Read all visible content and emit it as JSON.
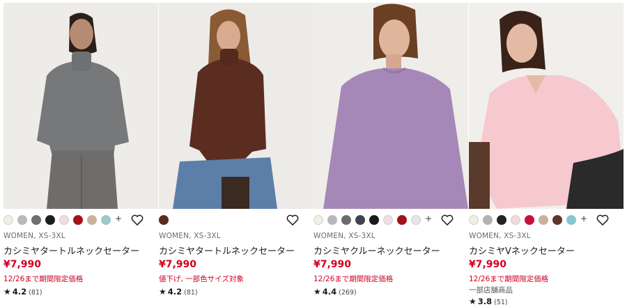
{
  "products": [
    {
      "meta": "WOMEN, XS-3XL",
      "name": "カシミヤタートルネックセーター",
      "price": "¥7,990",
      "promo": "12/26まで期間限定価格",
      "extra": "",
      "rating": "4.2",
      "reviews": "(81)",
      "swatches": [
        "#f2eee4",
        "#b9b9b9",
        "#6f6f6f",
        "#1e1e1e",
        "#f2dbe0",
        "#a5121c",
        "#c9b19c",
        "#9dc9c7"
      ],
      "photo_colors": {
        "bg": "#eeece9",
        "garment": "#777879",
        "bottom": "#6e6d6c",
        "skin": "#b58c72",
        "hair": "#2b1e18"
      }
    },
    {
      "meta": "WOMEN, XS-3XL",
      "name": "カシミヤタートルネックセーター",
      "price": "¥7,990",
      "promo": "値下げ, 一部色サイズ対象",
      "extra": "",
      "rating": "4.2",
      "reviews": "(81)",
      "swatches": [
        "#5a2a1d"
      ],
      "photo_colors": {
        "bg": "#ecebe8",
        "garment": "#5b2d20",
        "bottom": "#5b7fa8",
        "skin": "#d8ab90",
        "hair": "#8a5a35"
      }
    },
    {
      "meta": "WOMEN, XS-3XL",
      "name": "カシミヤクルーネックセーター",
      "price": "¥7,990",
      "promo": "12/26まで期間限定価格",
      "extra": "",
      "rating": "4.4",
      "reviews": "(269)",
      "swatches": [
        "#f3efe2",
        "#b7b7b7",
        "#6c6c6c",
        "#3d4450",
        "#1a1a1a",
        "#f2dde0",
        "#a3121b",
        "#e6e6e8"
      ],
      "photo_colors": {
        "bg": "#eeedea",
        "garment": "#a688b8",
        "bottom": "#a688b8",
        "skin": "#dfb59b",
        "hair": "#6b3f22"
      }
    },
    {
      "meta": "WOMEN, XS-3XL",
      "name": "カシミヤVネックセーター",
      "price": "¥7,990",
      "promo": "12/26まで期間限定価格",
      "extra": "一部店舗商品",
      "rating": "3.8",
      "reviews": "(51)",
      "swatches": [
        "#f2eee3",
        "#b2b2b2",
        "#232323",
        "#f2d9de",
        "#c8113a",
        "#cbb09c",
        "#63342a",
        "#86c6cf"
      ],
      "photo_colors": {
        "bg": "#f1efec",
        "garment": "#f6c9cf",
        "bottom": "#2a2a2a",
        "skin": "#e3bba4",
        "hair": "#3b2218"
      }
    }
  ],
  "icons": {
    "more": "+",
    "favorite": "heart-icon",
    "star": "★"
  }
}
